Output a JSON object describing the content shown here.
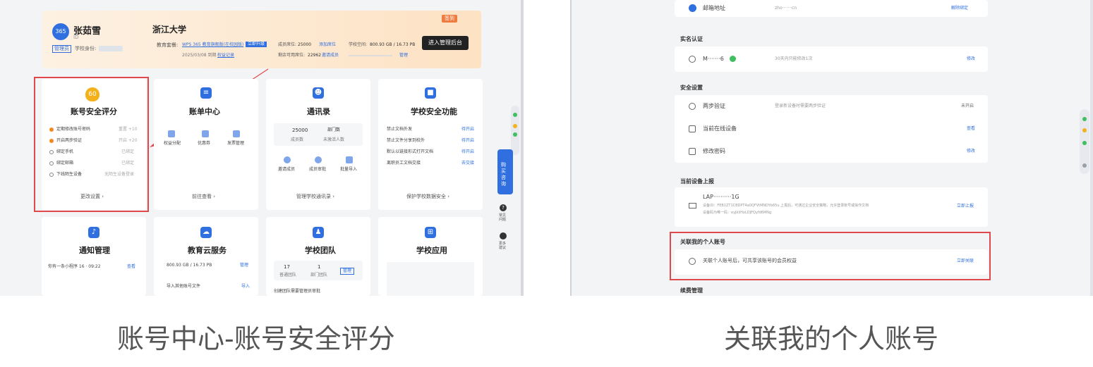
{
  "left": {
    "profile": {
      "name": "张茹雪",
      "sub": "ID",
      "role_badge": "管理员",
      "school_id_label": "学校身份:",
      "school": "浙江大学",
      "edu_label": "教育套餐:",
      "edu_value": "WPS 365 教育旗舰版(在校园版)",
      "upgrade": "立即升级",
      "expiry": "2025/03/08 到期",
      "record": "权益记录",
      "seats_label": "成员席位:",
      "seats_value": "25000",
      "seats_link": "添加席位",
      "auth_label": "剩余可用席位:",
      "auth_value": "22962",
      "auth_link": "邀请成员",
      "space_label": "学校空间:",
      "space_value": "800.93 GB / 16.73 PB",
      "space_link": "管理",
      "top_badge": "签到",
      "admin_btn": "进入管理后台"
    },
    "cards_row1": [
      {
        "title": "账号安全评分",
        "score": "60",
        "items": [
          {
            "label": "定期修改账号密码",
            "right": "重置 +10"
          },
          {
            "label": "开启两步验证",
            "right": "开启 +20"
          },
          {
            "label": "绑定手机",
            "right": "已绑定"
          },
          {
            "label": "绑定邮箱",
            "right": "已绑定"
          },
          {
            "label": "下线陌生设备",
            "right": "无陌生设备登录"
          }
        ],
        "footer": "更改设置 ›"
      },
      {
        "title": "账单中心",
        "icons": [
          "权益分配",
          "优惠券",
          "发票管理"
        ],
        "footer": "前往查看 ›"
      },
      {
        "title": "通讯录",
        "stats": [
          {
            "value": "25000",
            "label": "成员数"
          },
          {
            "value": "部门数",
            "label": "未激活人数"
          }
        ],
        "icons": [
          "邀请成员",
          "成员审批",
          "批量导入"
        ],
        "footer": "管理学校通讯录 ›"
      },
      {
        "title": "学校安全功能",
        "items": [
          {
            "label": "禁止文档外发",
            "right": "待开启"
          },
          {
            "label": "禁止文件分享到校外",
            "right": "待开启"
          },
          {
            "label": "默认以链接形式打开文档",
            "right": "待开启"
          },
          {
            "label": "离职员工文档交接",
            "right": "去交接"
          }
        ],
        "footer": "保护学校数据安全 ›"
      }
    ],
    "cards_row2": [
      {
        "title": "通知管理",
        "line": "你有一条小程序 16 · 09:22",
        "link": "查看"
      },
      {
        "title": "教育云服务",
        "line": "800.93 GB / 16.73 PB",
        "link": "管理",
        "line2": "导入其他账号文件",
        "link2": "导入"
      },
      {
        "title": "学校团队",
        "stat1": "17",
        "stat1_label": "普通团队",
        "stat2": "1",
        "stat2_label": "部门团队",
        "btn": "管理",
        "line": "创建团队需要管理员审批"
      },
      {
        "title": "学校应用"
      }
    ],
    "side_float": {
      "main": "购买咨询",
      "help": "常见问题",
      "feedback": "更多建议"
    }
  },
  "right": {
    "email_label": "邮箱地址",
    "email_value": "zho·······cn",
    "email_action": "解除绑定",
    "realname_section": "实名认证",
    "realname_value": "M·······6",
    "realname_hint": "30天内只能修改1次",
    "realname_action": "修改",
    "security_section": "安全设置",
    "security_rows": [
      {
        "label": "两步验证",
        "hint": "登录新设备时需要两步验证",
        "action": "未开启"
      },
      {
        "label": "当前在线设备",
        "hint": "",
        "action": "查看"
      },
      {
        "label": "修改密码",
        "hint": "",
        "action": "修改"
      }
    ],
    "device_section": "当前设备上报",
    "device_name": "LAP··········1G",
    "device_line1": "设备ID：FEB1ZT1CBDPT4a0QFVtMNDYb65u 上报后，可通过企业安全策略，允许登录账号或操作文档",
    "device_line2": "设备码为唯一码：eyJkIiHxLDJFQyfd6MNg",
    "device_action": "立即上报",
    "link_section": "关联我的个人账号",
    "link_text": "关联个人账号后，可共享该账号的会员权益",
    "link_action": "立即关联",
    "renew_section": "续费管理"
  },
  "captions": {
    "left": "账号中心-账号安全评分",
    "right": "关联我的个人账号"
  },
  "colors": {
    "accent": "#2f6fe0",
    "highlight": "#e0484b",
    "header_bg": "#fde4c6"
  }
}
